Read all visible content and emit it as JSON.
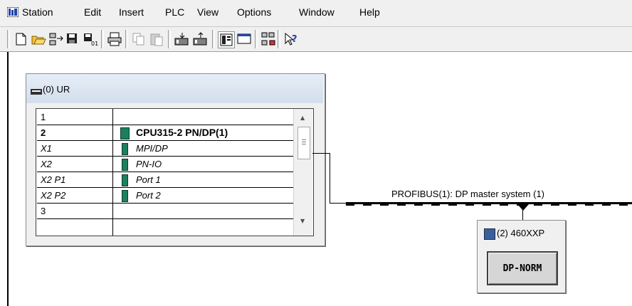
{
  "menu": [
    "Station",
    "Edit",
    "Insert",
    "PLC",
    "View",
    "Options",
    "Window",
    "Help"
  ],
  "toolbar": {
    "buttons": [
      "new-icon",
      "open-icon",
      "accessible-nodes-icon",
      "save-icon",
      "save-compile-icon",
      "print-icon",
      "copy-icon",
      "paste-icon",
      "download-icon",
      "upload-icon",
      "catalog-icon",
      "view-icon",
      "network-icon",
      "help-icon"
    ]
  },
  "rack": {
    "title": "(0) UR",
    "rows": [
      {
        "slot": "1",
        "module": "",
        "italic": false,
        "bold": false
      },
      {
        "slot": "2",
        "module": "CPU315-2 PN/DP(1)",
        "italic": false,
        "bold": true
      },
      {
        "slot": "X1",
        "module": "MPI/DP",
        "italic": true,
        "bold": false
      },
      {
        "slot": "X2",
        "module": "PN-IO",
        "italic": true,
        "bold": false
      },
      {
        "slot": "X2 P1",
        "module": "Port 1",
        "italic": true,
        "bold": false
      },
      {
        "slot": "X2 P2",
        "module": "Port 2",
        "italic": true,
        "bold": false
      },
      {
        "slot": "3",
        "module": "",
        "italic": false,
        "bold": false
      }
    ]
  },
  "network": {
    "bus_label": "PROFIBUS(1): DP master system (1)",
    "slave_title": "(2) 460XXP",
    "slave_module": "DP-NORM"
  }
}
